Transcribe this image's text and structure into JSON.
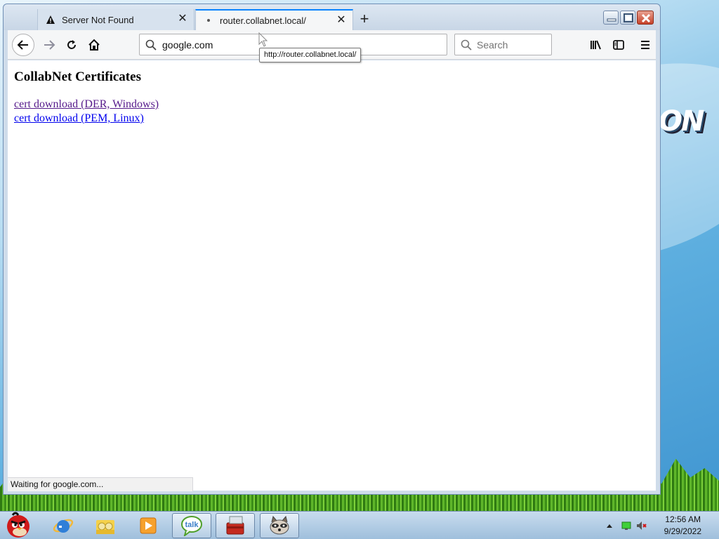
{
  "browser": {
    "tabs": [
      {
        "title": "Server Not Found",
        "icon": "warning-icon"
      },
      {
        "title": "router.collabnet.local/",
        "icon": "loading-dot-icon"
      }
    ],
    "new_tab_symbol": "+",
    "tab_close_symbol": "✕",
    "url_value": "google.com",
    "search_placeholder": "Search",
    "link_tooltip": "http://router.collabnet.local/",
    "status_text": "Waiting for google.com...",
    "icons": [
      "back-icon",
      "forward-icon",
      "reload-icon",
      "home-icon",
      "library-icon",
      "sidebar-icon",
      "menu-icon"
    ],
    "accent_color": "#0a84ff"
  },
  "page": {
    "heading": "CollabNet Certificates",
    "links": [
      {
        "label": "cert download (DER, Windows)",
        "visited": true
      },
      {
        "label": "cert download (PEM, Linux)",
        "visited": false
      }
    ],
    "link_color": "#0000ee",
    "visited_color": "#551a8b"
  },
  "taskbar": {
    "apps": [
      "angry-birds-start-icon",
      "internet-explorer-icon",
      "folder-icon",
      "media-player-icon",
      "google-talk-icon",
      "toolbox-icon",
      "raccoon-app-icon"
    ],
    "talk_label": "talk",
    "clock_time": "12:56 AM",
    "clock_date": "9/29/2022"
  }
}
